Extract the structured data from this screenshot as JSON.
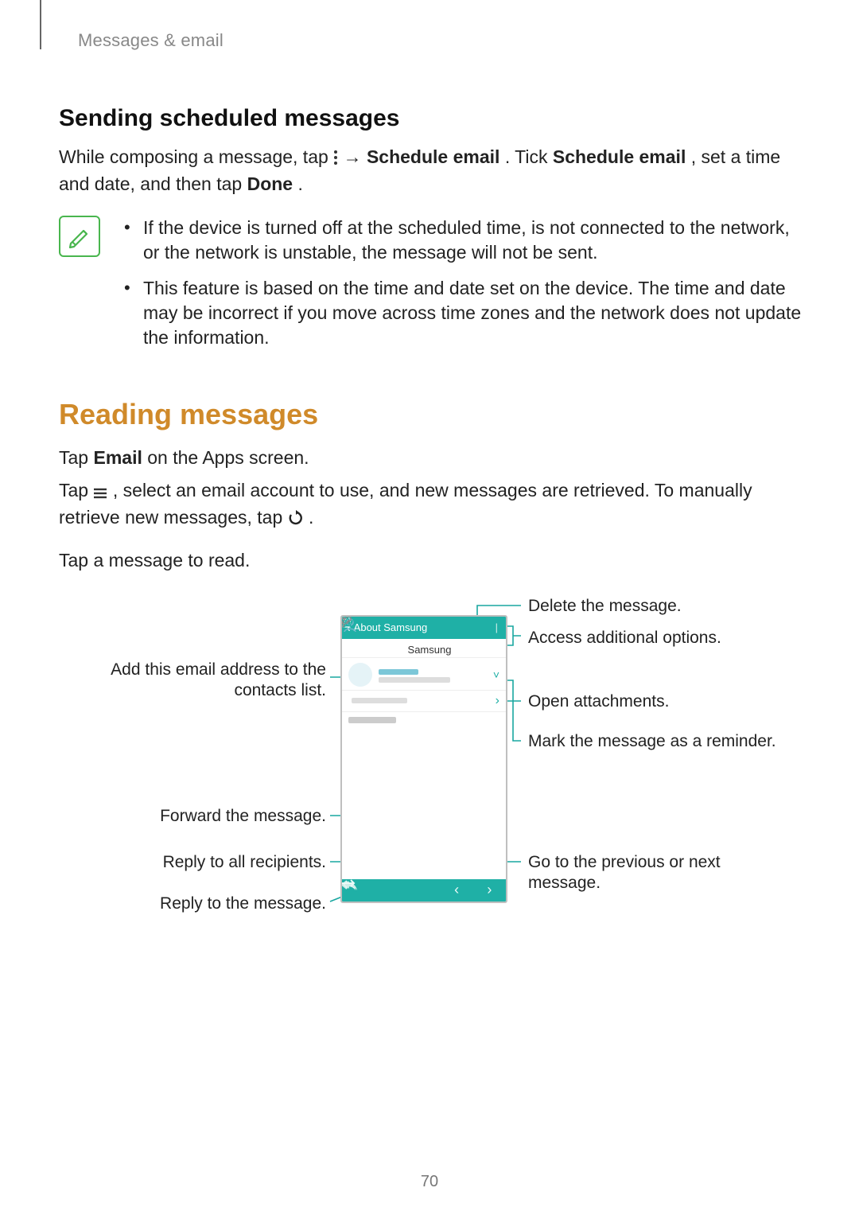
{
  "runningHead": "Messages & email",
  "pageNumber": "70",
  "sending": {
    "heading": "Sending scheduled messages",
    "para_pre": "While composing a message, tap ",
    "arrow": " → ",
    "bold1": "Schedule email",
    "mid1": ". Tick ",
    "bold2": "Schedule email",
    "mid2": ", set a time and date, and then tap ",
    "bold3": "Done",
    "end": "."
  },
  "notes": {
    "item1": "If the device is turned off at the scheduled time, is not connected to the network, or the network is unstable, the message will not be sent.",
    "item2": "This feature is based on the time and date set on the device. The time and date may be incorrect if you move across time zones and the network does not update the information."
  },
  "reading": {
    "heading": "Reading messages",
    "p1_pre": "Tap ",
    "p1_bold": "Email",
    "p1_post": " on the Apps screen.",
    "p2_pre": "Tap ",
    "p2_mid": ", select an email account to use, and new messages are retrieved. To manually retrieve new messages, tap ",
    "p2_end": ".",
    "p3": "Tap a message to read."
  },
  "callouts": {
    "delete": "Delete the message.",
    "options": "Access additional options.",
    "addContact": "Add this email address to the contacts list.",
    "attachments": "Open attachments.",
    "reminder": "Mark the message as a reminder.",
    "forward": "Forward the message.",
    "replyAll": "Reply to all recipients.",
    "reply": "Reply to the message.",
    "prevNext": "Go to the previous or next message."
  },
  "phone": {
    "backLabel": "About Samsung",
    "from": "Samsung"
  }
}
